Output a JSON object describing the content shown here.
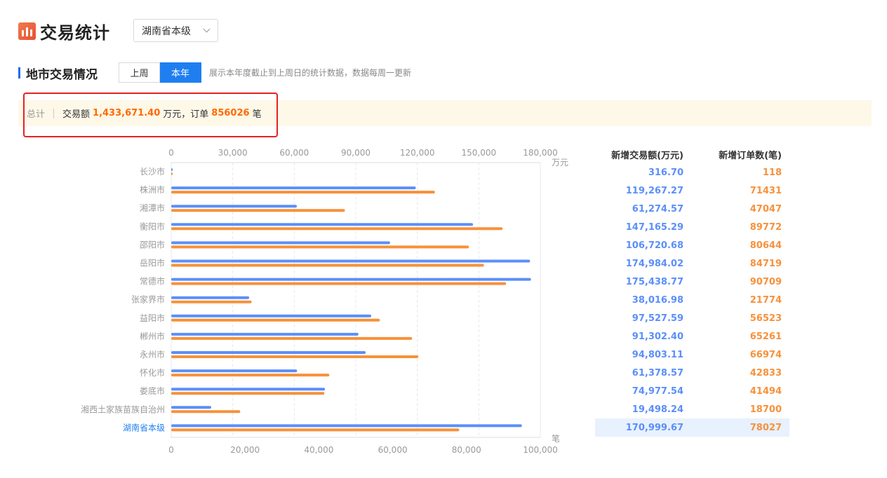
{
  "header": {
    "title": "交易统计",
    "region_select": "湖南省本级"
  },
  "section": {
    "title": "地市交易情况",
    "tabs": [
      {
        "label": "上周",
        "active": false
      },
      {
        "label": "本年",
        "active": true
      }
    ],
    "note": "展示本年度截止到上周日的统计数据，数据每周一更新"
  },
  "summary": {
    "label": "总计",
    "amount_prefix": "交易额",
    "amount": "1,433,671.40",
    "amount_unit": "万元，订单",
    "orders": "856026",
    "orders_unit": "笔"
  },
  "table": {
    "col_amount": "新增交易额(万元)",
    "col_orders": "新增订单数(笔)",
    "selected_index": 14
  },
  "colors": {
    "amount": "#5b8ff9",
    "orders": "#f7913a",
    "accent": "#1f7ff0",
    "highlight": "#e52222"
  },
  "chart_data": {
    "type": "bar",
    "orientation": "horizontal",
    "categories": [
      "长沙市",
      "株洲市",
      "湘潭市",
      "衡阳市",
      "邵阳市",
      "岳阳市",
      "常德市",
      "张家界市",
      "益阳市",
      "郴州市",
      "永州市",
      "怀化市",
      "娄底市",
      "湘西土家族苗族自治州",
      "湖南省本级"
    ],
    "series": [
      {
        "values": [
          316.7,
          119267.27,
          61274.57,
          147165.29,
          106720.68,
          174984.02,
          175438.77,
          38016.98,
          97527.59,
          91302.4,
          94803.11,
          61378.57,
          74977.54,
          19498.24,
          170999.67
        ],
        "display": [
          "316.70",
          "119,267.27",
          "61,274.57",
          "147,165.29",
          "106,720.68",
          "174,984.02",
          "175,438.77",
          "38,016.98",
          "97,527.59",
          "91,302.40",
          "94,803.11",
          "61,378.57",
          "74,977.54",
          "19,498.24",
          "170,999.67"
        ],
        "axis": "top"
      },
      {
        "values": [
          118,
          71431,
          47047,
          89772,
          80644,
          84719,
          90709,
          21774,
          56523,
          65261,
          66974,
          42833,
          41494,
          18700,
          78027
        ],
        "display": [
          "118",
          "71431",
          "47047",
          "89772",
          "80644",
          "84719",
          "90709",
          "21774",
          "56523",
          "65261",
          "66974",
          "42833",
          "41494",
          "18700",
          "78027"
        ],
        "axis": "bottom"
      }
    ],
    "top_axis": {
      "unit": "万元",
      "range": [
        0,
        180000
      ],
      "ticks": [
        "0",
        "30,000",
        "60,000",
        "90,000",
        "120,000",
        "150,000",
        "180,000"
      ]
    },
    "bottom_axis": {
      "unit": "笔",
      "range": [
        0,
        100000
      ],
      "ticks": [
        "0",
        "20,000",
        "40,000",
        "60,000",
        "80,000",
        "100,000"
      ]
    },
    "grid": true
  }
}
